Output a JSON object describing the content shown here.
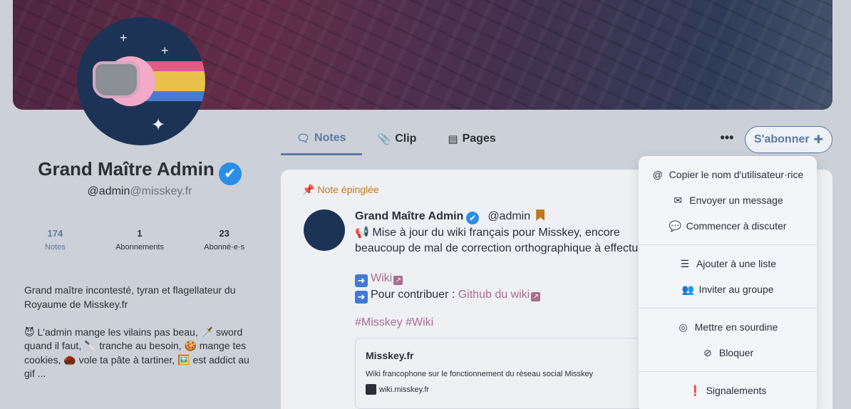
{
  "profile": {
    "display_name": "Grand Maître Admin",
    "username": "@admin",
    "host": "@misskey.fr",
    "stats": [
      {
        "value": "174",
        "label": "Notes"
      },
      {
        "value": "1",
        "label": "Abonnements"
      },
      {
        "value": "23",
        "label": "Abonné·e·s"
      }
    ],
    "bio": "Grand maître incontesté, tyran et flagellateur du Royaume de Misskey.fr\n\n😈 L'admin mange les vilains pas beau, 🗡️ sword quand il faut, 🔪 tranche au besoin, 🍪 mange tes cookies, 🌰 vole ta pâte à tartiner, 🖼️ est addict au gif ..."
  },
  "tabs": [
    {
      "label": "Notes",
      "icon": "comment-icon"
    },
    {
      "label": "Clip",
      "icon": "paperclip-icon"
    },
    {
      "label": "Pages",
      "icon": "file-icon"
    }
  ],
  "actions": {
    "more": "•••",
    "subscribe": "S'abonner"
  },
  "note": {
    "pinned_label": "Note épinglée",
    "author": "Grand Maître Admin",
    "username": "@admin",
    "text": "Mise à jour du wiki français pour Misskey, encore beaucoup de mal de correction orthographique à effectuer.",
    "wiki_link": "Wiki",
    "contribute_prefix": "Pour contribuer : ",
    "github_link": "Github du wiki",
    "hashtags": "#Misskey #Wiki",
    "preview": {
      "title": "Misskey.fr",
      "description": "Wiki francophone sur le fonctionnement du réseau social Misskey",
      "site": "wiki.misskey.fr"
    }
  },
  "menu": [
    {
      "label": "Copier le nom d'utilisateur·rice",
      "icon": "at-icon"
    },
    {
      "label": "Envoyer un message",
      "icon": "envelope-icon"
    },
    {
      "label": "Commencer à discuter",
      "icon": "chat-icon"
    },
    {
      "label": "Ajouter à une liste",
      "icon": "list-icon"
    },
    {
      "label": "Inviter au groupe",
      "icon": "users-icon"
    },
    {
      "label": "Mettre en sourdine",
      "icon": "eye-slash-icon"
    },
    {
      "label": "Bloquer",
      "icon": "ban-icon"
    },
    {
      "label": "Signalements",
      "icon": "alert-icon"
    }
  ],
  "colors": {
    "accent": "#5b7aa3",
    "pin": "#c07a1c",
    "link": "#a86d8f",
    "verified": "#2a8ee6"
  }
}
